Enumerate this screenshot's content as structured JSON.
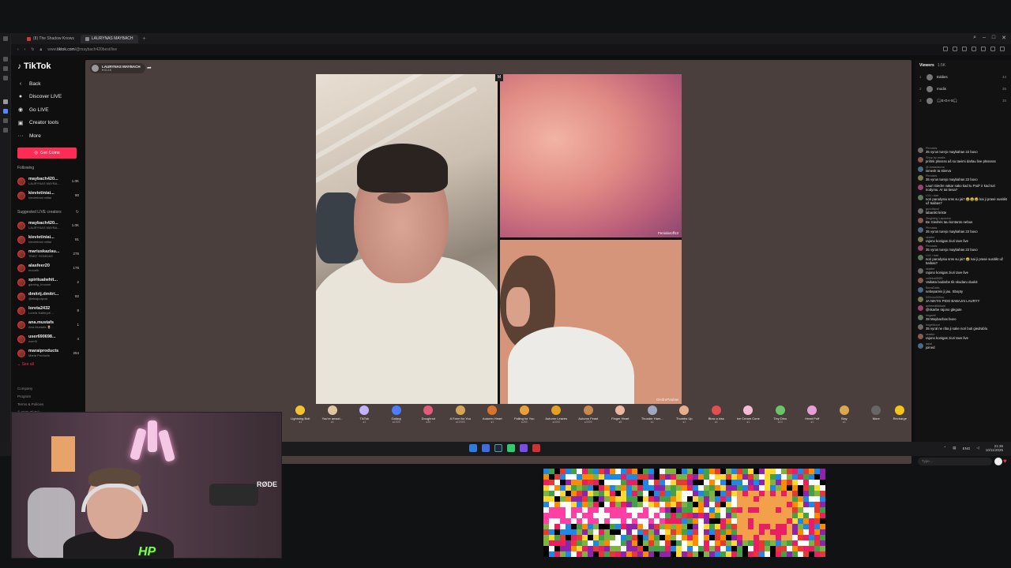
{
  "browser": {
    "tabs": [
      {
        "label": "(8) The Shadow Knows",
        "active": false
      },
      {
        "label": "LAURYNAS MAYBACH",
        "active": true
      }
    ],
    "new_tab": "+",
    "url_prefix": "www.",
    "url_domain": "tiktok.com",
    "url_path": "/@maybach420best/live"
  },
  "tiktok": {
    "brand": "TikTok",
    "nav": [
      {
        "icon": "‹",
        "label": "Back"
      },
      {
        "icon": "●",
        "label": "Discover LIVE"
      },
      {
        "icon": "◉",
        "label": "Go LIVE"
      },
      {
        "icon": "▣",
        "label": "Creator tools"
      },
      {
        "icon": "···",
        "label": "More"
      }
    ],
    "get_coins": "Get Coins",
    "following_label": "Following",
    "following": [
      {
        "name": "maybach420...",
        "sub": "LAURYNAS MAYBA...",
        "count": "1.0K"
      },
      {
        "name": "kievietiniai...",
        "sub": "kievietiniai miltai",
        "count": "90"
      }
    ],
    "suggested_label": "Suggested LIVE creators",
    "suggested": [
      {
        "name": "maybach420...",
        "sub": "LAURYNAS MAYBA...",
        "count": "1.0K"
      },
      {
        "name": "kievietiniai...",
        "sub": "kievietiniai miltai",
        "count": "91"
      },
      {
        "name": "mariuskazlau...",
        "sub": "\"EMO\" ROMOAS",
        "count": "276"
      },
      {
        "name": "alasfeer20",
        "sub": "mooeth",
        "count": "176"
      },
      {
        "name": "spiritualwhit...",
        "sub": "gaming_imoose",
        "count": "2"
      },
      {
        "name": "dmitrij.dmitri...",
        "sub": "@ekiajudpvar",
        "count": "92"
      },
      {
        "name": "loreta2432",
        "sub": "Loreta Kalibrydi ...",
        "count": "8"
      },
      {
        "name": "ana.mustafs",
        "sub": "Ana Mustafa 🌷...",
        "count": "1"
      },
      {
        "name": "user690698...",
        "sub": "userl3",
        "count": "4"
      },
      {
        "name": "maraiproducts",
        "sub": "Maria Products",
        "count": "254"
      }
    ],
    "see_all": "See all",
    "footer": [
      "Company",
      "Program",
      "Terms & Policies",
      "© 2025 TikTok"
    ]
  },
  "live": {
    "host_name": "LAURYNAS MAYBACH",
    "host_likes": "♥ 51.1K",
    "cam_label_1": "Fenixlaroff13",
    "cam_label_2": "GiedrePaulaw",
    "mute": "M",
    "gifts": [
      {
        "name": "Lightning Bolt",
        "cost": "●1",
        "color": "#f4c430"
      },
      {
        "name": "You're amazi...",
        "cost": "●1",
        "color": "#e0c7a4"
      },
      {
        "name": "TikTok",
        "cost": "●1",
        "color": "#c4b3ff"
      },
      {
        "name": "Galaxy",
        "cost": "●1000",
        "color": "#4d7cff"
      },
      {
        "name": "Doughnut",
        "cost": "●30",
        "color": "#e35a7a"
      },
      {
        "name": "A Farm for You",
        "cost": "●12000",
        "color": "#d4a65a"
      },
      {
        "name": "Autumn Heart",
        "cost": "●1",
        "color": "#d8752c"
      },
      {
        "name": "Falling for You",
        "cost": "●260",
        "color": "#e8a23c"
      },
      {
        "name": "Autumn Leaves",
        "cost": "●1000",
        "color": "#e3a021"
      },
      {
        "name": "Autumn Feast",
        "cost": "●3000",
        "color": "#c88a4a"
      },
      {
        "name": "Finger Heart",
        "cost": "●5",
        "color": "#f0b7a0"
      },
      {
        "name": "Thunder Ham...",
        "cost": "●1",
        "color": "#a0a8c0"
      },
      {
        "name": "Thumbs Up",
        "cost": "●1",
        "color": "#e7b08c"
      },
      {
        "name": "Blow a kiss",
        "cost": "●1",
        "color": "#e05050"
      },
      {
        "name": "Ice Cream Cone",
        "cost": "●1",
        "color": "#f5bcd4"
      },
      {
        "name": "Tiny Dino",
        "cost": "●10",
        "color": "#6ac46a"
      },
      {
        "name": "Heart Puff",
        "cost": "●1",
        "color": "#e5a0d8"
      },
      {
        "name": "Slay",
        "cost": "●1",
        "color": "#d8a850"
      },
      {
        "name": "More",
        "cost": "",
        "color": "#666666"
      }
    ],
    "recharge": "Recharge"
  },
  "chat": {
    "viewers_label": "Viewers",
    "viewers_count": "1.5K",
    "top_viewers": [
      {
        "rank": "1",
        "name": "Eddies",
        "points": "44"
      },
      {
        "rank": "2",
        "name": "modis",
        "points": "35"
      },
      {
        "rank": "3",
        "name": "🎧E-G-I-S🎧",
        "points": "15"
      }
    ],
    "messages": [
      {
        "user": "Pinnasis",
        "text": "35 vyrus turejo maybahas 22 buvo"
      },
      {
        "user": "Shop by mada",
        "text": "prilmk plsssss aš su tavimi darlau live plssssss"
      },
      {
        "user": "@Jurdadsona",
        "text": "ismesk ta stierva"
      },
      {
        "user": "Pinnasis",
        "text": "35 vyrus turejo maybahas 22 buvo"
      },
      {
        "user": "",
        "text": "Lauri Giedre vakar sako kad tu Pod* ir kad turi irodymu. Ar tai tiesa?"
      },
      {
        "user": "LV4 • bad",
        "text": "nori parodysiu sms su jai? 😂😂😂 kai ji prasė susitikt už 5aibas?"
      },
      {
        "user": "guccifacol",
        "text": "labanikt kriste"
      },
      {
        "user": "Zieglidrig Laposinn",
        "text": "Be Giedrės tau kontanto nebus"
      },
      {
        "user": "Pinnasis",
        "text": "35 vyrus turejo maybahas 22 buvo"
      },
      {
        "user": "skarbe",
        "text": "rajono konigas ziuri tave live"
      },
      {
        "user": "Pinnasis",
        "text": "35 vyrus turejo maybahas 22 buvo"
      },
      {
        "user": "LV4 • bad",
        "text": "nori parodysiu sms su jai? 😂 kai ji prasė susitikt už 5aibas?"
      },
      {
        "user": "skarbe",
        "text": "rajono konigas ziuri tave live"
      },
      {
        "user": "collekar5555",
        "text": "Vaikata bodarbe tik skudaru duokit"
      },
      {
        "user": "BanaDaks",
        "text": "nebepareis ji jau. Sbopty"
      },
      {
        "user": "000ooo000oo",
        "text": "JA NIKTAI PIDO BABAJAI LAURYY"
      },
      {
        "user": "antieedilibikald",
        "text": "@skarbe rajono glegute"
      },
      {
        "user": "Imgantt",
        "text": "28 Maybachas buvo"
      },
      {
        "user": "hugeblood",
        "text": "35 vyral ne riba ji sake nori buti giedrablu"
      },
      {
        "user": "skarbe",
        "text": "rajono konigas ziuri tave live"
      },
      {
        "user": "aalai",
        "text": "joined"
      }
    ],
    "input_placeholder": "Type..."
  },
  "taskbar": {
    "lang": "ENG",
    "time": "21:36",
    "date": "10/11/2025"
  },
  "webcam": {
    "mic_brand": "RØDE",
    "logo": "HP"
  }
}
